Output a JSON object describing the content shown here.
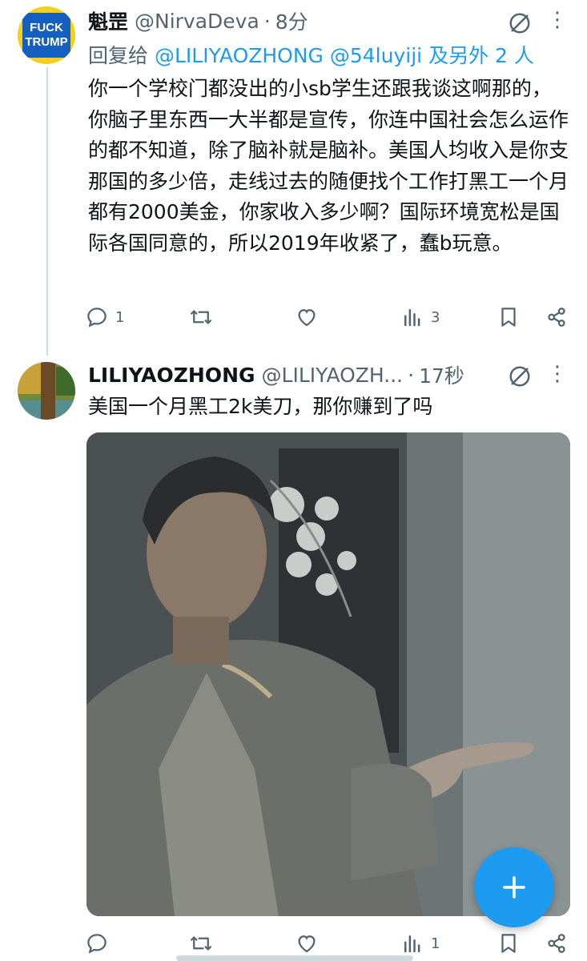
{
  "tweet1": {
    "avatar_text": [
      "FUCK",
      "TRUMP"
    ],
    "name": "魁罡",
    "handle": "@NirvaDeva",
    "separator": "·",
    "time": "8分",
    "reply_prefix": "回复给",
    "reply_mentions": "@LILIYAOZHONG @54luyiji",
    "reply_suffix": "及另外 2 人",
    "text": "你一个学校门都没出的小sb学生还跟我谈这啊那的，你脑子里东西一大半都是宣传，你连中国社会怎么运作的都不知道，除了脑补就是脑补。美国人均收入是你支那国的多少倍，走线过去的随便找个工作打黑工一个月都有2000美金，你家收入多少啊？国际环境宽松是国际各国同意的，所以2019年收紧了，蠢b玩意。",
    "actions": {
      "replies": "1",
      "retweets": "",
      "likes": "",
      "views": "3"
    }
  },
  "tweet2": {
    "name": "LILIYAOZHONG",
    "handle": "@LILIYAOZH...",
    "separator": "·",
    "time": "17秒",
    "text": "美国一个月黑工2k美刀，那你赚到了吗",
    "actions": {
      "replies": "",
      "retweets": "",
      "likes": "",
      "views": "1"
    }
  },
  "colors": {
    "accent": "#1d9bf0",
    "muted": "#536471",
    "text": "#0f1419",
    "thread_line": "#cfd9de"
  },
  "fab": {
    "icon": "plus-icon"
  }
}
